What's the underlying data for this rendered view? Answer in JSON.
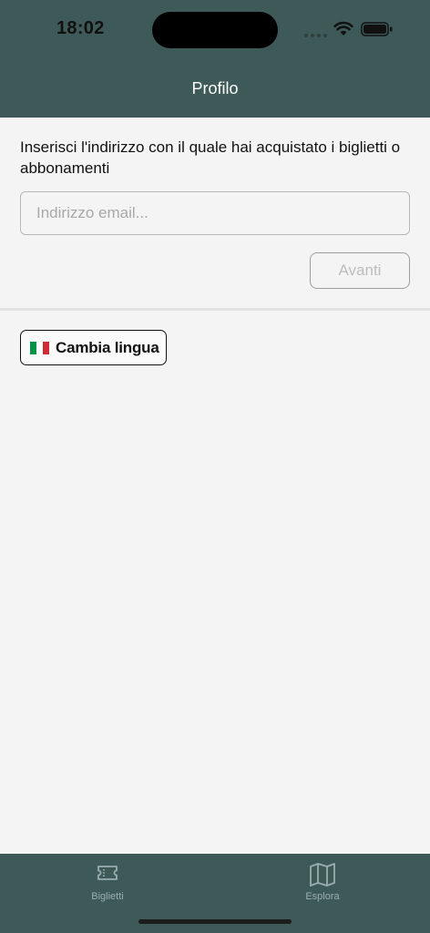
{
  "status_bar": {
    "time": "18:02"
  },
  "header": {
    "title": "Profilo"
  },
  "login": {
    "prompt": "Inserisci l'indirizzo con il quale hai acquistato i biglietti o abbonamenti",
    "email_placeholder": "Indirizzo email...",
    "email_value": "",
    "next_label": "Avanti"
  },
  "language": {
    "button_label": "Cambia lingua",
    "flag_colors": [
      "#009246",
      "#ffffff",
      "#ce2b37"
    ]
  },
  "tabbar": {
    "tabs": [
      {
        "label": "Biglietti",
        "icon": "ticket-icon"
      },
      {
        "label": "Esplora",
        "icon": "map-icon"
      }
    ]
  },
  "colors": {
    "header_bg": "#3e5a58",
    "tab_inactive": "#9aaeac"
  }
}
